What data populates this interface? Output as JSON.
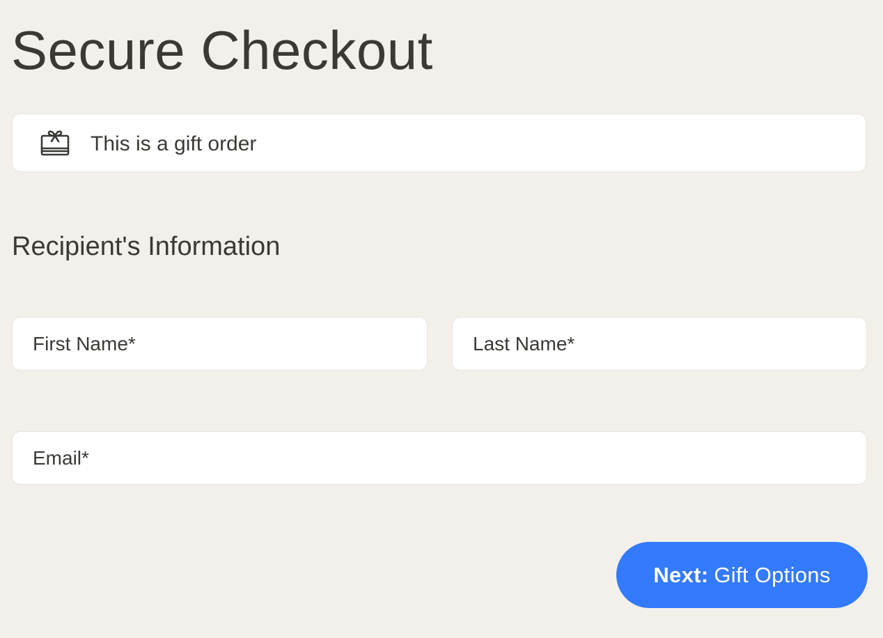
{
  "header": {
    "title": "Secure Checkout"
  },
  "gift_order": {
    "icon": "gift-card-icon",
    "label": "This is a gift order"
  },
  "recipient": {
    "section_title": "Recipient's Information",
    "first_name": {
      "value": "",
      "placeholder": "First Name*"
    },
    "last_name": {
      "value": "",
      "placeholder": "Last Name*"
    },
    "email": {
      "value": "",
      "placeholder": "Email*"
    }
  },
  "actions": {
    "next_prefix": "Next:",
    "next_label": "Gift Options",
    "next_color": "#337afc"
  },
  "colors": {
    "background": "#f3f0eb",
    "text": "#3b3935",
    "card": "#ffffff"
  }
}
